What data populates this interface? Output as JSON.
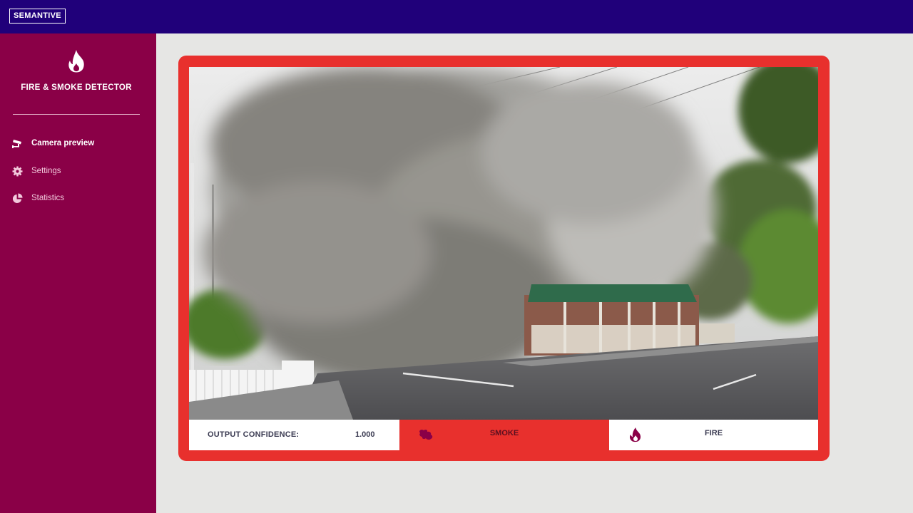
{
  "header": {
    "brand": "SEMANTIVE"
  },
  "sidebar": {
    "app_title": "FIRE & SMOKE DETECTOR",
    "logo_icon": "flame-icon",
    "items": [
      {
        "label": "Camera preview",
        "icon": "cctv-camera-icon",
        "active": true
      },
      {
        "label": "Settings",
        "icon": "gear-icon",
        "active": false
      },
      {
        "label": "Statistics",
        "icon": "pie-chart-icon",
        "active": false
      }
    ]
  },
  "result": {
    "confidence_label": "OUTPUT CONFIDENCE:",
    "confidence_value": "1.000",
    "smoke_label": "SMOKE",
    "fire_label": "FIRE",
    "smoke_icon": "smoke-icon",
    "fire_icon": "flame-icon",
    "detected": "SMOKE"
  },
  "colors": {
    "topbar": "#20007a",
    "sidebar": "#8a0047",
    "alert": "#e8302d",
    "background": "#e6e6e4"
  }
}
